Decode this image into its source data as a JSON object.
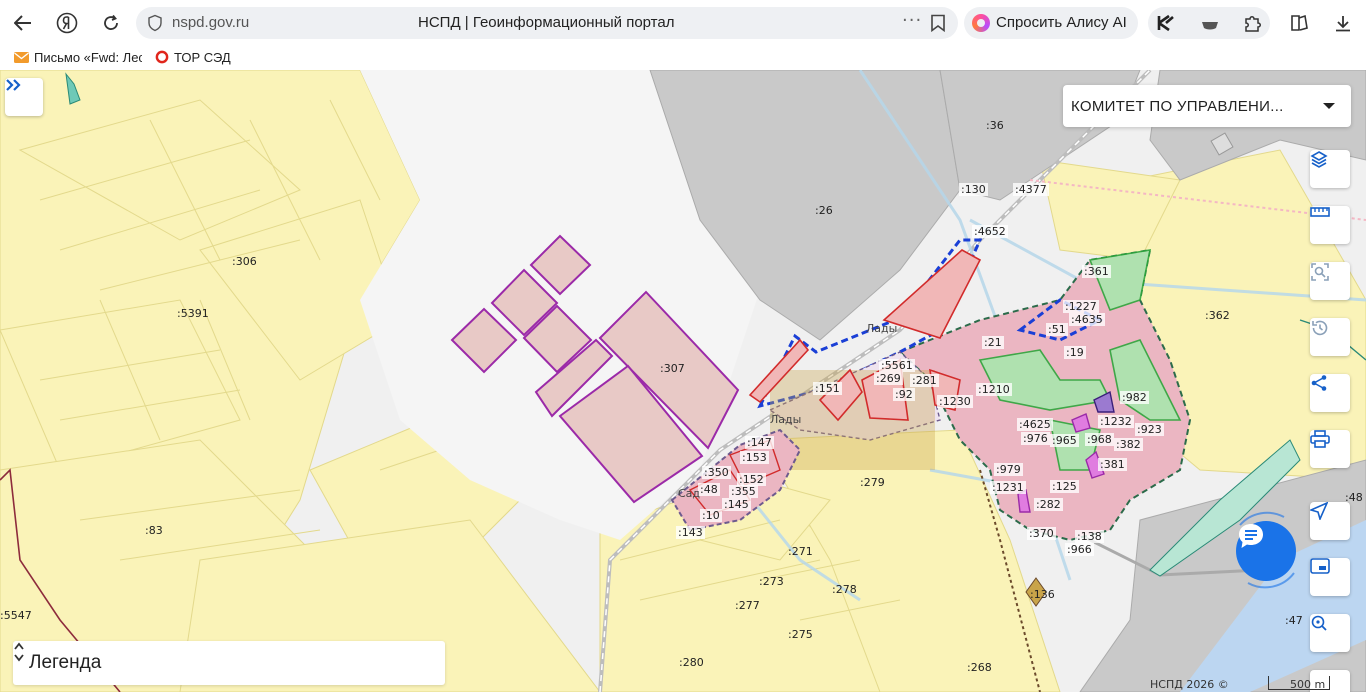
{
  "browser": {
    "domain": "nspd.gov.ru",
    "page_title": "НСПД | Геоинформационный портал",
    "alice_label": "Спросить Алису AI",
    "bookmarks": [
      {
        "label": "Письмо «Fwd: Лес",
        "icon": "mail-icon"
      },
      {
        "label": "ТОР СЭД",
        "icon": "ring-icon"
      }
    ]
  },
  "map": {
    "layer_select": "КОМИТЕТ ПО УПРАВЛЕНИ...",
    "legend_label": "Легенда",
    "copyright": "НСПД 2026 ©",
    "scale_label": "500 m",
    "parcel_labels": [
      ":36",
      ":130",
      ":4377",
      ":26",
      ":4652",
      ":306",
      ":5391",
      ":307",
      ":361",
      ":1227",
      ":4635",
      ":51",
      ":362",
      ":19",
      ":21",
      ":5561",
      ":269",
      ":281",
      ":151",
      ":92",
      ":1210",
      ":1230",
      ":982",
      ":1232",
      ":923",
      ":4625",
      ":976",
      ":965",
      ":968",
      ":382",
      ":381",
      ":147",
      ":153",
      ":350",
      ":152",
      ":48",
      ":355",
      ":145",
      ":10",
      ":143",
      ":279",
      ":979",
      ":1231",
      ":125",
      ":282",
      ":370",
      ":138",
      ":966",
      ":83",
      ":271",
      ":273",
      ":278",
      ":277",
      ":275",
      ":136",
      ":5547",
      ":280",
      ":268",
      ":47",
      ":48"
    ],
    "place_labels": [
      "Лады",
      "Лады",
      "Сад"
    ]
  },
  "tools": {
    "icons": [
      "layers-icon",
      "ruler-icon",
      "select-area-icon",
      "history-icon",
      "share-icon",
      "print-icon",
      "locate-icon",
      "picture-in-picture-icon",
      "search-location-icon"
    ]
  },
  "colors": {
    "parcel_yellow": "#faf3b8",
    "parcel_grey": "#c8c8c8",
    "zone_pink": "#e9b8c2",
    "zone_purple": "#9b2aa8",
    "zone_blue_dash": "#1a3fd6",
    "zone_green": "#9fe6a4",
    "accent_blue": "#1a73e8"
  }
}
